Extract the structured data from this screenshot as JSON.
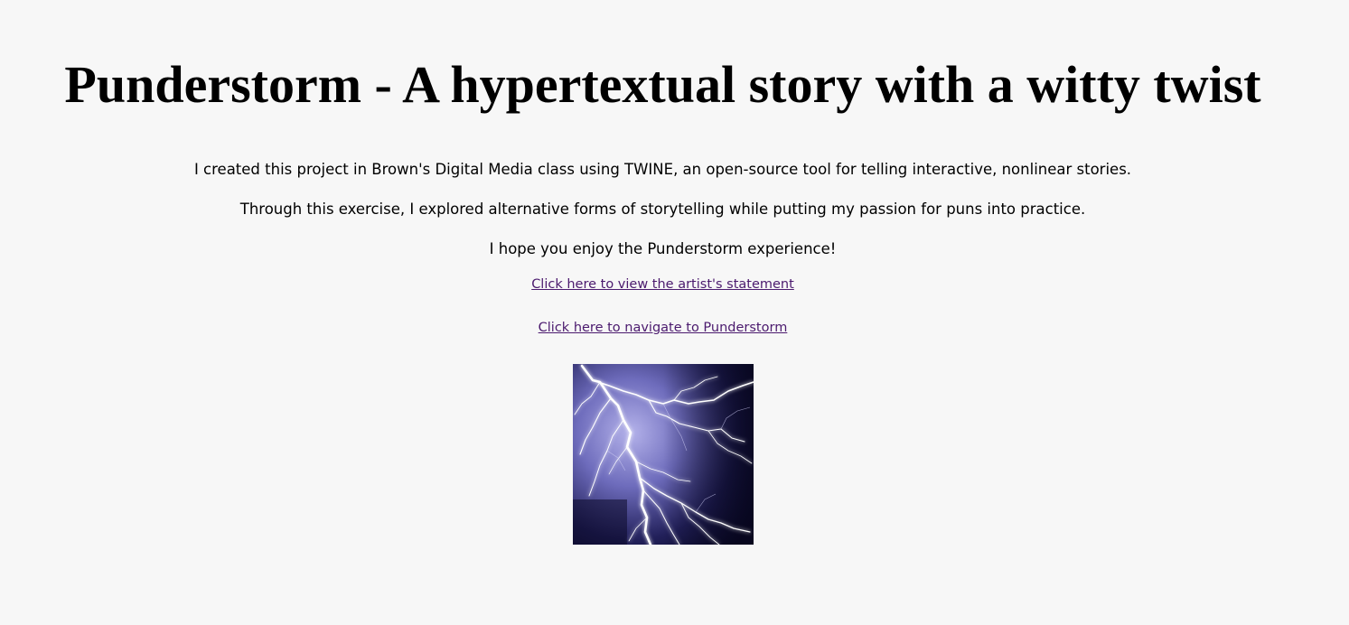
{
  "page": {
    "title": "Punderstorm - A hypertextual story with a witty twist",
    "intro": [
      "I created this project in Brown's Digital Media class using TWINE, an open-source tool for telling interactive, nonlinear stories.",
      "Through this exercise, I explored alternative forms of storytelling while putting my passion for puns into practice.",
      "I hope you enjoy the Punderstorm experience!"
    ],
    "links": [
      "Click here to view the artist's statement",
      "Click here to navigate to Punderstorm"
    ],
    "image": {
      "icon": "lightning-bolt-image"
    }
  },
  "colors": {
    "background": "#f7f7f7",
    "text": "#000000",
    "link": "#4b1a6e",
    "storm_dark": "#07061e",
    "storm_light": "#9a98d8"
  }
}
